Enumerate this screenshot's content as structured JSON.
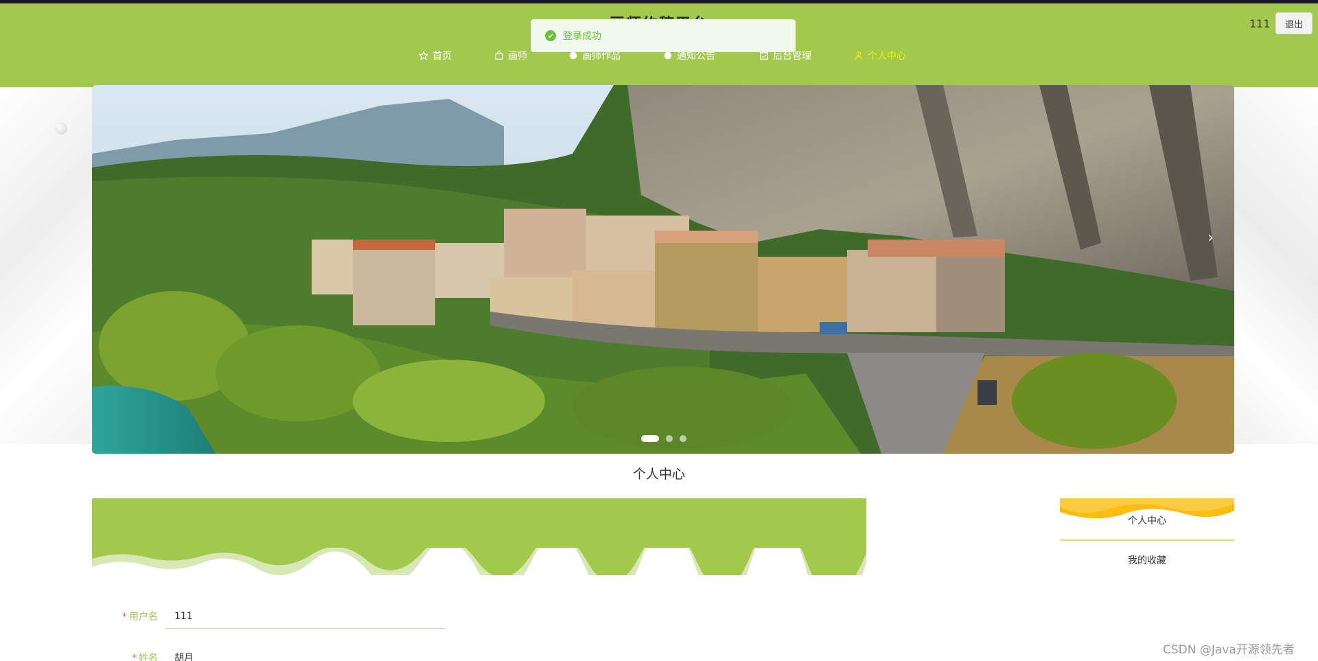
{
  "app": {
    "title": "画师约稿平台",
    "user": "111",
    "logout_label": "退出"
  },
  "nav": {
    "items": [
      {
        "label": "首页",
        "icon": "star-icon"
      },
      {
        "label": "画师",
        "icon": "bag-icon"
      },
      {
        "label": "画师作品",
        "icon": "dot-icon"
      },
      {
        "label": "通知公告",
        "icon": "dot-icon"
      },
      {
        "label": "后台管理",
        "icon": "calendar-icon"
      },
      {
        "label": "个人中心",
        "icon": "user-icon",
        "active": true
      }
    ]
  },
  "toast": {
    "message": "登录成功",
    "type": "success"
  },
  "carousel": {
    "slide_count": 3,
    "active_index": 0,
    "next_arrow": "›"
  },
  "section": {
    "title": "个人中心"
  },
  "sidebar_menu": {
    "items": [
      {
        "label": "个人中心",
        "active": true
      },
      {
        "label": "我的收藏"
      }
    ]
  },
  "form": {
    "fields": [
      {
        "label": "用户名",
        "required": true,
        "value": "111"
      },
      {
        "label": "姓名",
        "required": true,
        "value": "胡月"
      }
    ]
  },
  "watermark": "CSDN @Java开源领先者",
  "colors": {
    "primary": "#a2c94b",
    "accent": "#f4f000",
    "underline": "#f0d660",
    "success": "#67c23a",
    "menu_head": "#fbbd10"
  }
}
